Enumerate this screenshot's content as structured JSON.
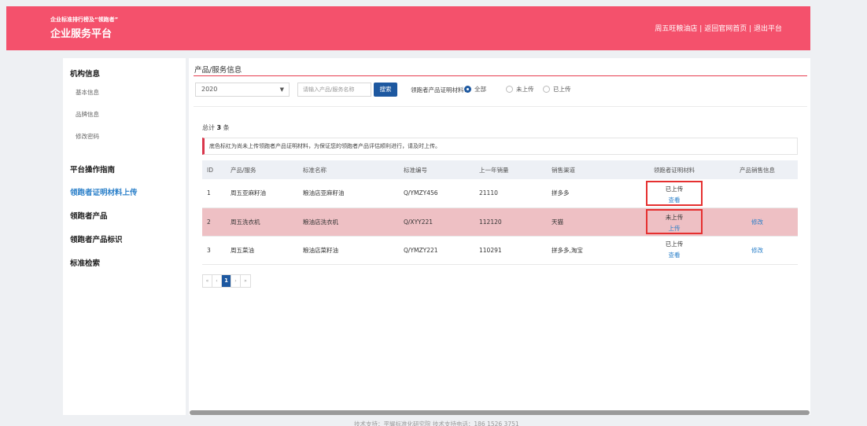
{
  "header": {
    "subtitle": "企业标准排行榜及“领跑者”",
    "title": "企业服务平台",
    "links": [
      "周五旺粮油店",
      "返回官网首页",
      "退出平台"
    ],
    "separator": " | "
  },
  "sidebar": {
    "groups": [
      {
        "label": "机构信息",
        "children": [
          "基本信息",
          "品牌信息",
          "修改密码"
        ]
      },
      {
        "label": "平台操作指南",
        "children": []
      },
      {
        "label": "领跑者证明材料上传",
        "children": [],
        "active": true
      },
      {
        "label": "领跑者产品",
        "children": []
      },
      {
        "label": "领跑者产品标识",
        "children": []
      },
      {
        "label": "标准检索",
        "children": []
      }
    ]
  },
  "main": {
    "section_title": "产品/服务信息",
    "filters": {
      "year_value": "2020",
      "search_placeholder": "请输入产品/服务名称",
      "search_button": "搜索",
      "proof_label": "领跑者产品证明材料：",
      "options": [
        {
          "label": "全部",
          "checked": true
        },
        {
          "label": "未上传",
          "checked": false
        },
        {
          "label": "已上传",
          "checked": false
        }
      ]
    },
    "total_prefix": "总计",
    "total_count": "3",
    "total_suffix": "条",
    "notice": "底色标红为尚未上传领跑者产品证明材料，为保证您的领跑者产品评估顺利进行，请及时上传。",
    "table": {
      "columns": [
        "ID",
        "产品/服务",
        "标准名称",
        "标准编号",
        "上一年销量",
        "销售渠道",
        "领跑者证明材料",
        "产品销售信息"
      ],
      "rows": [
        {
          "id": "1",
          "product": "周五亚麻籽油",
          "std_name": "粮油店亚麻籽油",
          "std_no": "Q/YMZY456",
          "sales": "21110",
          "channel": "拼多多",
          "proof_status": "已上传",
          "proof_action": "查看",
          "sales_info": "",
          "missing": false,
          "boxed": true
        },
        {
          "id": "2",
          "product": "周五洗衣机",
          "std_name": "粮油店洗衣机",
          "std_no": "Q/XYY221",
          "sales": "112120",
          "channel": "天猫",
          "proof_status": "未上传",
          "proof_action": "上传",
          "sales_info": "修改",
          "missing": true,
          "boxed": true
        },
        {
          "id": "3",
          "product": "周五菜油",
          "std_name": "粮油店菜籽油",
          "std_no": "Q/YMZY221",
          "sales": "110291",
          "channel": "拼多多,淘宝",
          "proof_status": "已上传",
          "proof_action": "查看",
          "sales_info": "修改",
          "missing": false,
          "boxed": false
        }
      ]
    },
    "pagination": {
      "first": "«",
      "prev": "‹",
      "current": "1",
      "next": "›",
      "last": "»"
    }
  },
  "footer": {
    "text": "技术支持：平耀标准化研究院  技术支持电话：186 1526 3751"
  },
  "colors": {
    "brand": "#f4516c",
    "primary": "#1d58a0",
    "link": "#2a7fc9",
    "alert_row": "#eec0c4",
    "highlight_border": "#e53030"
  }
}
